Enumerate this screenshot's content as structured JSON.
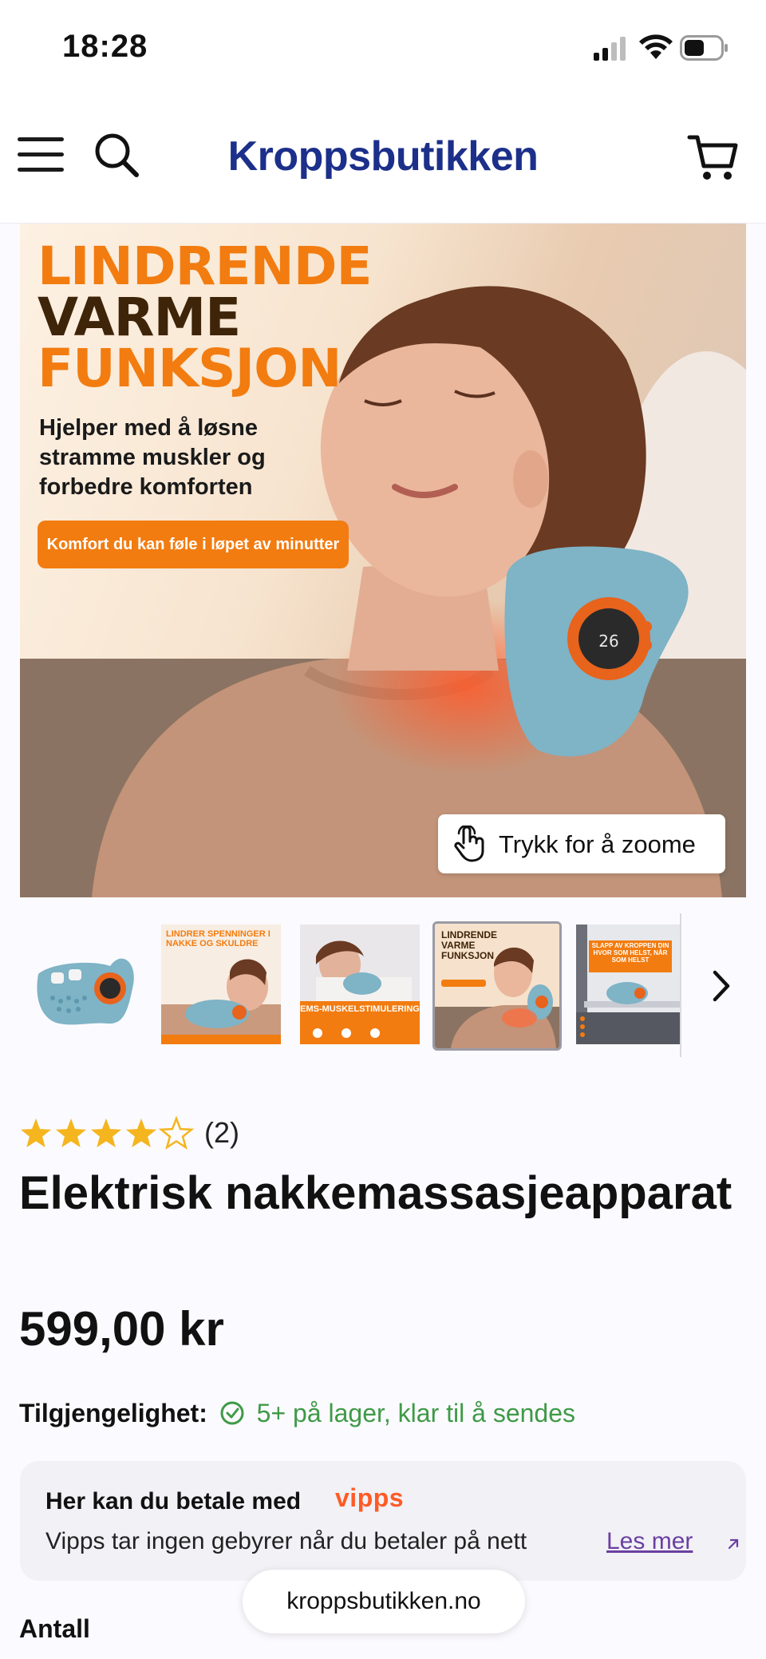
{
  "status_bar": {
    "time": "18:28"
  },
  "header": {
    "logo": "Kroppsbutikken"
  },
  "hero": {
    "headline_line1": "LINDRENDE",
    "headline_line2": "VARME",
    "headline_line3": "FUNKSJON",
    "subtitle": "Hjelper med å løsne stramme muskler og forbedre komforten",
    "pill": "Komfort du kan føle i løpet av minutter",
    "device_display": "26",
    "zoom_label": "Trykk for å zoome"
  },
  "thumbnails": [
    {
      "caption": ""
    },
    {
      "caption": "LINDRER SPENNINGER I NAKKE OG SKULDRE"
    },
    {
      "caption": "EMS-MUSKELSTIMULERING"
    },
    {
      "caption": "LINDRENDE VARME FUNKSJON"
    },
    {
      "caption": "SLAPP AV KROPPEN DIN HVOR SOM HELST, NÅR SOM HELST"
    }
  ],
  "product": {
    "rating": 4,
    "rating_max": 5,
    "rating_count": "(2)",
    "title": "Elektrisk nakkemassasjeapparat",
    "price": "599,00 kr",
    "availability_label": "Tilgjengelighet:",
    "availability_value": "5+ på lager, klar til å sendes"
  },
  "vipps": {
    "heading": "Her kan du betale med",
    "brand": "vipps",
    "text": "Vipps tar ingen gebyrer når du betaler på nett",
    "link": "Les mer"
  },
  "quantity_label": "Antall",
  "browser": {
    "url": "kroppsbutikken.no"
  },
  "colors": {
    "accent_orange": "#f27c10",
    "brand_blue": "#1c2f8a",
    "stock_green": "#3f9a47",
    "vipps_orange": "#ff5b24",
    "link_purple": "#6b3fa0",
    "star_gold": "#f4b51e"
  }
}
